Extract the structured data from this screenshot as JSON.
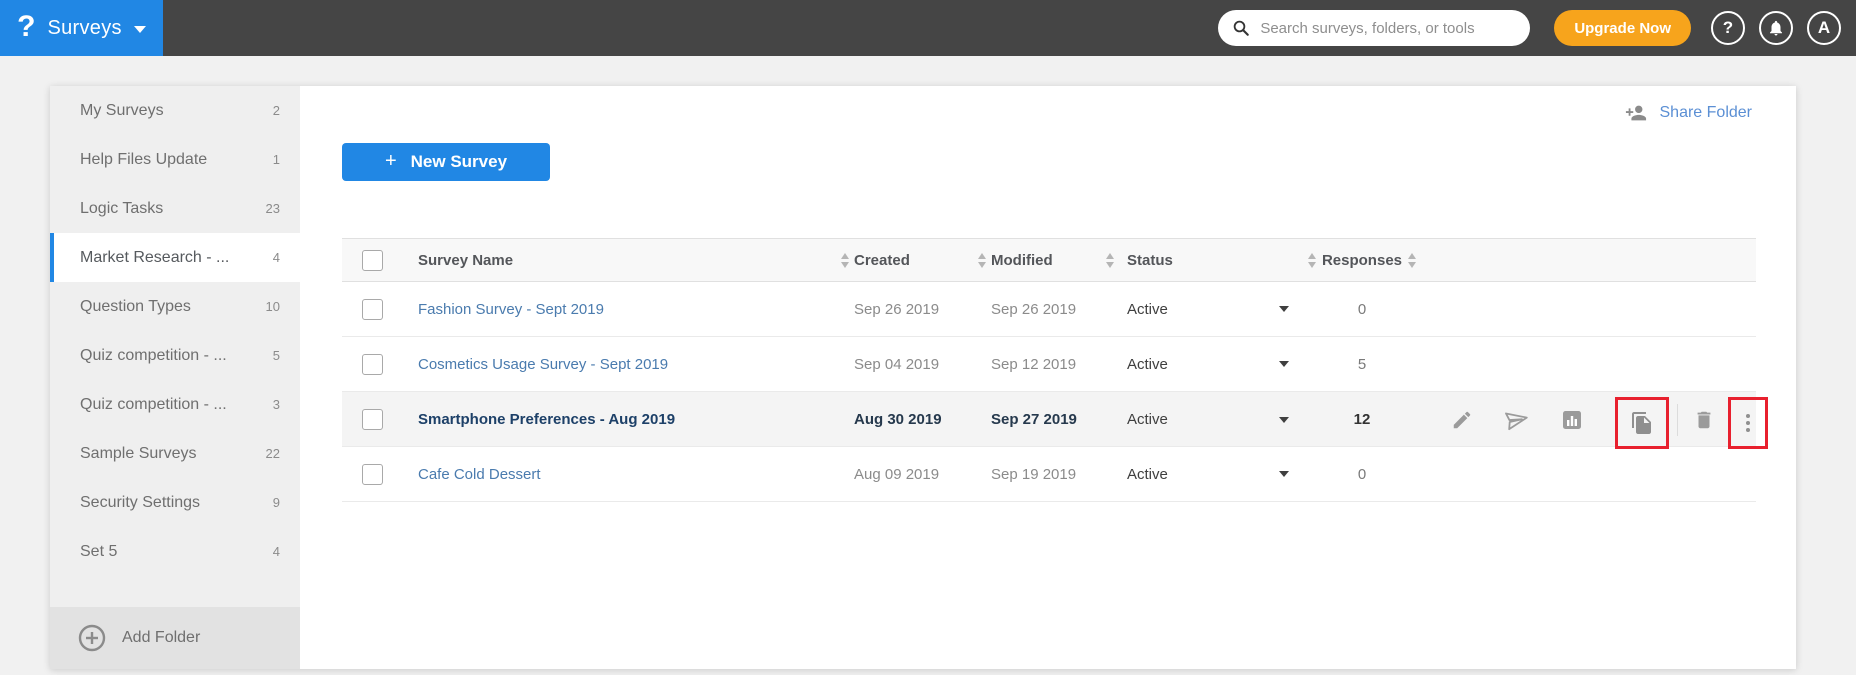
{
  "topbar": {
    "logo_glyph": "?",
    "app_name": "Surveys",
    "search_placeholder": "Search surveys, folders, or tools",
    "upgrade_label": "Upgrade Now",
    "help_glyph": "?",
    "avatar_initial": "A"
  },
  "sidebar": {
    "items": [
      {
        "label": "My Surveys",
        "count": "2"
      },
      {
        "label": "Help Files Update",
        "count": "1"
      },
      {
        "label": "Logic Tasks",
        "count": "23"
      },
      {
        "label": "Market Research - ...",
        "count": "4"
      },
      {
        "label": "Question Types",
        "count": "10"
      },
      {
        "label": "Quiz competition - ...",
        "count": "5"
      },
      {
        "label": "Quiz competition - ...",
        "count": "3"
      },
      {
        "label": "Sample Surveys",
        "count": "22"
      },
      {
        "label": "Security Settings",
        "count": "9"
      },
      {
        "label": "Set 5",
        "count": "4"
      }
    ],
    "add_folder_label": "Add Folder"
  },
  "main": {
    "new_survey_plus": "+",
    "new_survey_label": "New Survey",
    "share_folder_label": "Share Folder",
    "table": {
      "headers": {
        "name": "Survey Name",
        "created": "Created",
        "modified": "Modified",
        "status": "Status",
        "responses": "Responses"
      },
      "rows": [
        {
          "name": "Fashion Survey - Sept 2019",
          "created": "Sep 26 2019",
          "modified": "Sep 26 2019",
          "status": "Active",
          "responses": "0"
        },
        {
          "name": "Cosmetics Usage Survey - Sept 2019",
          "created": "Sep 04 2019",
          "modified": "Sep 12 2019",
          "status": "Active",
          "responses": "5"
        },
        {
          "name": "Smartphone Preferences - Aug 2019",
          "created": "Aug 30 2019",
          "modified": "Sep 27 2019",
          "status": "Active",
          "responses": "12"
        },
        {
          "name": "Cafe Cold Dessert",
          "created": "Aug 09 2019",
          "modified": "Sep 19 2019",
          "status": "Active",
          "responses": "0"
        }
      ]
    }
  },
  "colors": {
    "accent_blue": "#2187e4",
    "upgrade_orange": "#f7a41c",
    "topbar_dark": "#454545",
    "annotation_red": "#e8202e",
    "link_blue": "#4a7bae"
  }
}
